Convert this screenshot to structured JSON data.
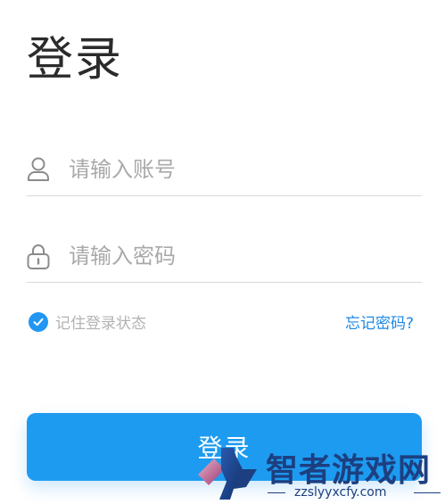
{
  "page": {
    "title": "登录"
  },
  "form": {
    "account": {
      "placeholder": "请输入账号",
      "icon": "user-icon"
    },
    "password": {
      "placeholder": "请输入密码",
      "icon": "lock-icon"
    },
    "remember": {
      "label": "记住登录状态",
      "checked": true,
      "icon": "check-icon"
    },
    "forgot_label": "忘记密码?",
    "submit_label": "登录"
  },
  "watermark": {
    "name": "智者游戏网",
    "url": "zzslyyxcfy.com"
  },
  "colors": {
    "accent": "#1d9bf0",
    "link": "#1e88e5",
    "title": "#2b2b2b",
    "placeholder": "#a9a9a9",
    "divider": "#d9d9d9",
    "watermark": "#1d3f80"
  }
}
